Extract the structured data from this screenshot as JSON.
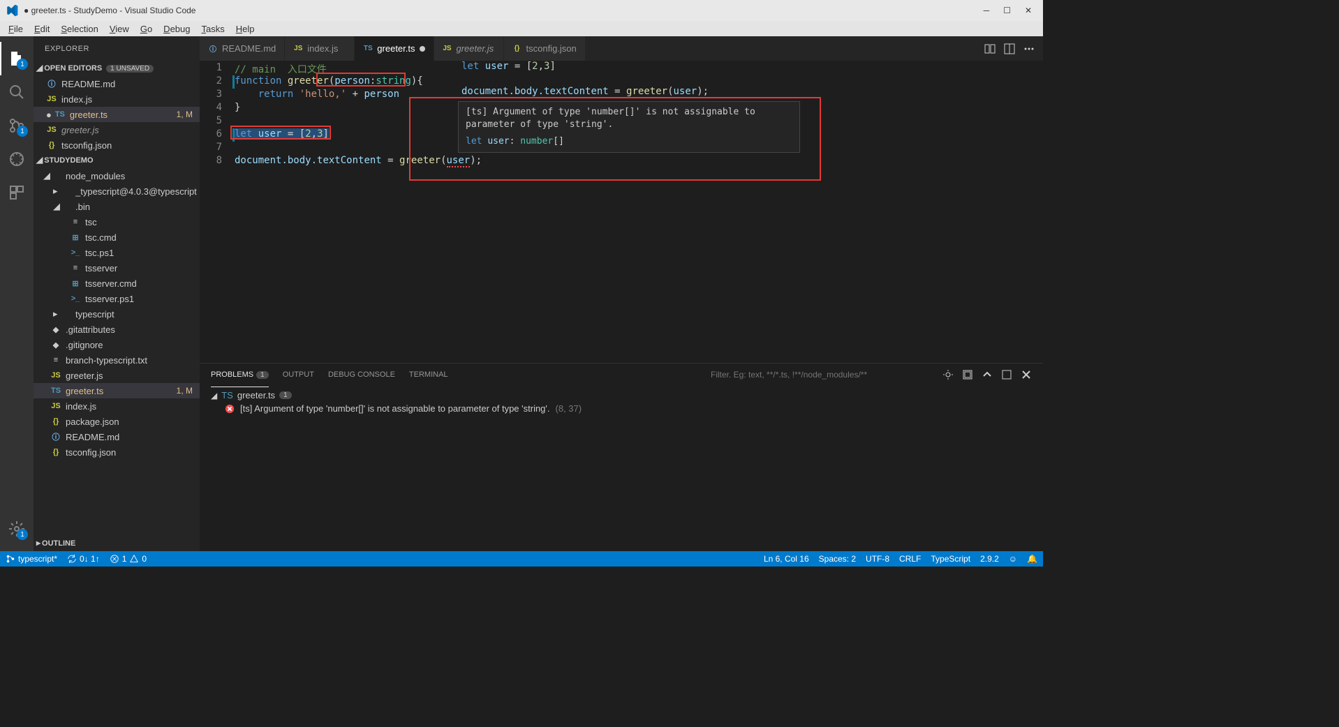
{
  "window": {
    "title": "● greeter.ts - StudyDemo - Visual Studio Code"
  },
  "menu": {
    "file": "File",
    "edit": "Edit",
    "selection": "Selection",
    "view": "View",
    "go": "Go",
    "debug": "Debug",
    "tasks": "Tasks",
    "help": "Help"
  },
  "activity": {
    "explorer_badge": "1",
    "scm_badge": "1",
    "settings_badge": "1"
  },
  "explorer": {
    "title": "EXPLORER",
    "open_editors": "OPEN EDITORS",
    "unsaved_badge": "1 UNSAVED",
    "project": "STUDYDEMO",
    "outline": "OUTLINE",
    "open_items": [
      {
        "icon": "info",
        "label": "README.md"
      },
      {
        "icon": "js",
        "label": "index.js"
      },
      {
        "icon": "ts",
        "label": "greeter.ts",
        "modified": true,
        "status": "1, M",
        "active": true,
        "dirty": true
      },
      {
        "icon": "js",
        "label": "greeter.js",
        "italic": true
      },
      {
        "icon": "json",
        "label": "tsconfig.json"
      }
    ],
    "tree": [
      {
        "depth": 0,
        "type": "folder-open",
        "label": "node_modules"
      },
      {
        "depth": 1,
        "type": "folder",
        "label": "_typescript@4.0.3@typescript"
      },
      {
        "depth": 1,
        "type": "folder-open",
        "label": ".bin"
      },
      {
        "depth": 2,
        "type": "file",
        "label": "tsc"
      },
      {
        "depth": 2,
        "type": "cmd",
        "label": "tsc.cmd"
      },
      {
        "depth": 2,
        "type": "ps1",
        "label": "tsc.ps1"
      },
      {
        "depth": 2,
        "type": "file",
        "label": "tsserver"
      },
      {
        "depth": 2,
        "type": "cmd",
        "label": "tsserver.cmd"
      },
      {
        "depth": 2,
        "type": "ps1",
        "label": "tsserver.ps1"
      },
      {
        "depth": 1,
        "type": "folder",
        "label": "typescript"
      },
      {
        "depth": 0,
        "type": "git",
        "label": ".gitattributes"
      },
      {
        "depth": 0,
        "type": "git",
        "label": ".gitignore"
      },
      {
        "depth": 0,
        "type": "txt",
        "label": "branch-typescript.txt"
      },
      {
        "depth": 0,
        "type": "js",
        "label": "greeter.js"
      },
      {
        "depth": 0,
        "type": "ts",
        "label": "greeter.ts",
        "modified": true,
        "status": "1, M",
        "active": true
      },
      {
        "depth": 0,
        "type": "js",
        "label": "index.js"
      },
      {
        "depth": 0,
        "type": "json",
        "label": "package.json"
      },
      {
        "depth": 0,
        "type": "info",
        "label": "README.md"
      },
      {
        "depth": 0,
        "type": "json",
        "label": "tsconfig.json"
      }
    ]
  },
  "tabs": [
    {
      "icon": "info",
      "label": "README.md"
    },
    {
      "icon": "js",
      "label": "index.js"
    },
    {
      "icon": "ts",
      "label": "greeter.ts",
      "active": true,
      "dirty": true
    },
    {
      "icon": "js",
      "label": "greeter.js",
      "italic": true
    },
    {
      "icon": "json",
      "label": "tsconfig.json"
    }
  ],
  "editor": {
    "lines": [
      1,
      2,
      3,
      4,
      5,
      6,
      7,
      8
    ],
    "modified_lines": [
      2,
      6
    ],
    "comment": "// main  入口文件",
    "fn_kw": "function",
    "fn_name": "greeter",
    "param_name": "person",
    "param_type": "string",
    "return_kw": "return",
    "ret_str": "'hello,'",
    "plus": " + ",
    "ret_var": "person",
    "let_kw": "let",
    "user_var": "user",
    "eq": " = ",
    "bracket_l": "[",
    "n2": "2",
    "comma": ",",
    "n3": "3",
    "bracket_r": "]",
    "doc_body": "document",
    "body_prop": ".body",
    "tc_prop": ".textContent",
    "assign": " = ",
    "call_fn": "greeter",
    "lparen": "(",
    "user_arg": "user",
    "rparen": ");"
  },
  "hover": {
    "preview_line1": "let user = [2,3]",
    "preview_line2": "document.body.textContent = greeter(user);",
    "err_msg": "[ts] Argument of type 'number[]' is not assignable to parameter of type 'string'.",
    "sig": "let user: number[]"
  },
  "panel": {
    "problems": "PROBLEMS",
    "problems_count": "1",
    "output": "OUTPUT",
    "debug": "DEBUG CONSOLE",
    "terminal": "TERMINAL",
    "filter_placeholder": "Filter. Eg: text, **/*.ts, !**/node_modules/**",
    "file": "greeter.ts",
    "file_count": "1",
    "msg_src": "[ts]",
    "msg": "Argument of type 'number[]' is not assignable to parameter of type 'string'.",
    "loc": "(8, 37)"
  },
  "status": {
    "branch": "typescript*",
    "sync": "0↓ 1↑",
    "errors": "1",
    "warnings": "0",
    "ln_col": "Ln 6, Col 16",
    "spaces": "Spaces: 2",
    "encoding": "UTF-8",
    "eol": "CRLF",
    "lang": "TypeScript",
    "version": "2.9.2"
  }
}
